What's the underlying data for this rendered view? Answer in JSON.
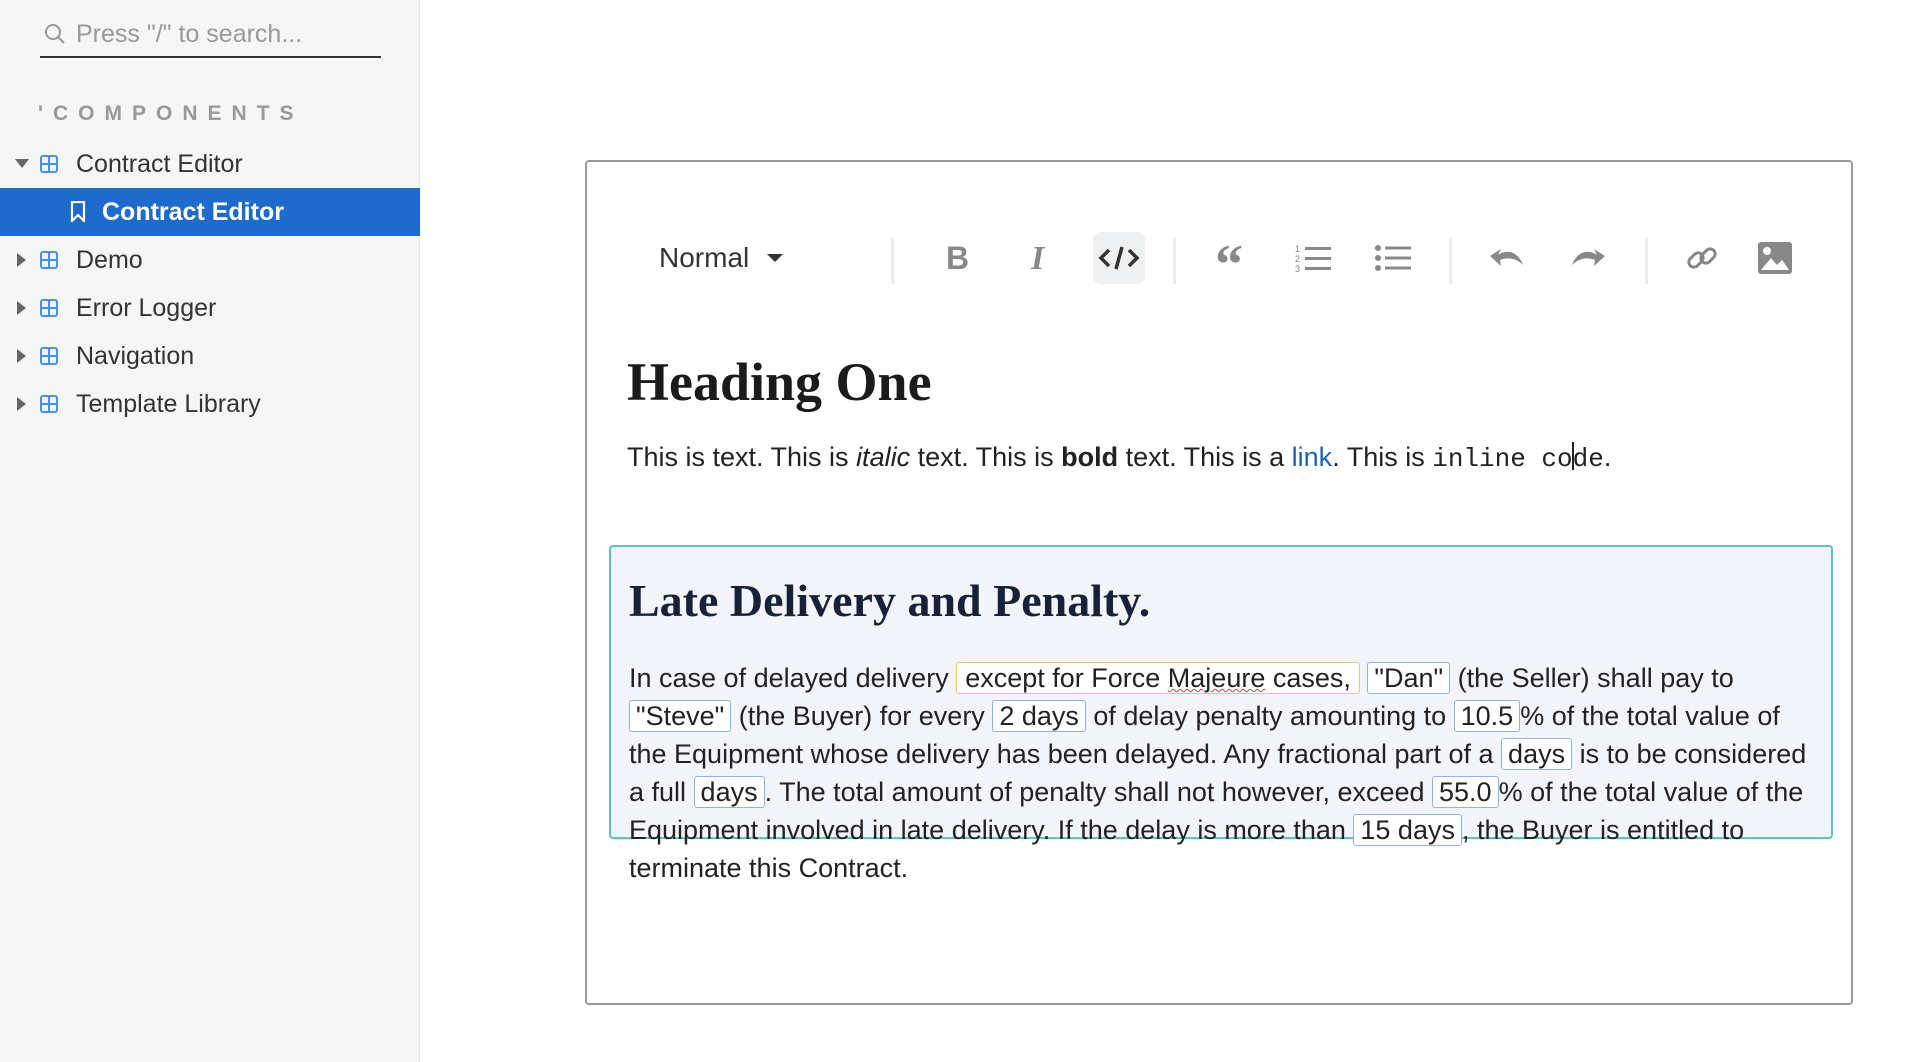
{
  "sidebar": {
    "search_placeholder": "Press \"/\" to search...",
    "section_title": "'COMPONENTS",
    "items": [
      {
        "label": "Contract Editor",
        "expanded": true
      },
      {
        "label": "Contract Editor",
        "selected": true
      },
      {
        "label": "Demo"
      },
      {
        "label": "Error Logger"
      },
      {
        "label": "Navigation"
      },
      {
        "label": "Template Library"
      }
    ]
  },
  "toolbar": {
    "block_style": "Normal",
    "buttons": [
      "bold-icon",
      "italic-icon",
      "code-icon",
      "quote-icon",
      "ordered-list-icon",
      "unordered-list-icon",
      "undo-icon",
      "redo-icon",
      "link-icon",
      "image-icon"
    ],
    "active_button": "code-icon"
  },
  "document": {
    "heading": "Heading One",
    "para": {
      "t1": "This is text. This is ",
      "italic": "italic",
      "t2": " text. This is ",
      "bold": "bold",
      "t3": " text. This is a ",
      "link": "link",
      "t4": ". This is ",
      "code_a": "inline co",
      "code_b": "de",
      "t5": "."
    }
  },
  "clause": {
    "title": "Late Delivery and Penalty.",
    "s1": "In case of delayed delivery ",
    "cond_a": "except for Force ",
    "cond_squig": "Majeure",
    "cond_b": " cases,",
    "seller": "\"Dan\"",
    "s2": " (the Seller) shall pay to",
    "buyer": "\"Steve\"",
    "s3": " (the Buyer) for every ",
    "penalty_duration": "2 days",
    "s4": " of delay penalty amounting to ",
    "penalty_pct": "10.5",
    "s5": "% of the total value of the Equipment whose delivery has been delayed. Any fractional part of a ",
    "frac_unit": "days",
    "s6": " is to be considered a full ",
    "full_unit": "days",
    "s7": ". The total amount of penalty shall not however, exceed ",
    "cap_pct": "55.0",
    "s8": "% of the total value of the Equipment involved in late delivery. If the delay is more than ",
    "termination": "15 days",
    "s9": ", the Buyer is entitled to terminate this Contract."
  },
  "colors": {
    "selected_bg": "#1e6bcc",
    "clause_border": "#5cc5bd",
    "variable_border": "#8fb3e6",
    "conditional_border": "#f4c27a",
    "link": "#1e5fb8"
  }
}
